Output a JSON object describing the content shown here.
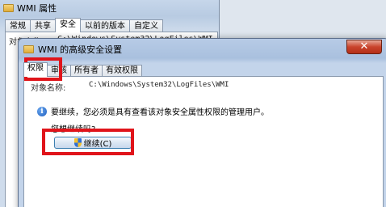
{
  "back_window": {
    "title": "WMI 属性",
    "tabs": [
      {
        "label": "常规",
        "active": false
      },
      {
        "label": "共享",
        "active": false
      },
      {
        "label": "安全",
        "active": true
      },
      {
        "label": "以前的版本",
        "active": false
      },
      {
        "label": "自定义",
        "active": false
      }
    ],
    "object_label": "对象名称:",
    "object_value": "C:\\Windows\\System32\\LogFiles\\WMI"
  },
  "dialog": {
    "title": "WMI 的高级安全设置",
    "close_glyph": "✕",
    "tabs": [
      {
        "label": "权限",
        "active": true
      },
      {
        "label": "审核",
        "active": false
      },
      {
        "label": "所有者",
        "active": false
      },
      {
        "label": "有效权限",
        "active": false
      }
    ],
    "object_label": "对象名称:",
    "object_value": "C:\\Windows\\System32\\LogFiles\\WMI",
    "info_icon": "i",
    "info_text": "要继续，您必须是具有查看该对象安全属性权限的管理用户。",
    "question": "您想继续吗?",
    "continue_label": "继续(C)"
  },
  "colors": {
    "highlight": "#e0141a",
    "close_button": "#c9432c"
  },
  "icons": [
    "folder-icon",
    "close-icon",
    "info-icon",
    "shield-icon"
  ]
}
